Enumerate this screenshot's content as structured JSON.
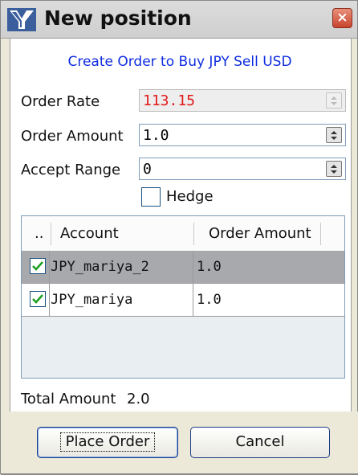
{
  "window": {
    "title": "New position",
    "close_symbol": "×"
  },
  "headline": "Create Order to Buy JPY Sell USD",
  "form": {
    "order_rate_label": "Order Rate",
    "order_rate_value": "113.15",
    "order_rate_color": "#e11a1a",
    "order_amount_label": "Order Amount",
    "order_amount_value": "1.0",
    "accept_range_label": "Accept Range",
    "accept_range_value": "0",
    "hedge_label": "Hedge",
    "hedge_checked": false
  },
  "table": {
    "columns": [
      "..",
      "Account",
      "Order Amount"
    ],
    "rows": [
      {
        "checked": true,
        "account": "JPY_mariya_2",
        "amount": "1.0",
        "selected": true
      },
      {
        "checked": true,
        "account": "JPY_mariya",
        "amount": "1.0",
        "selected": false
      }
    ]
  },
  "total": {
    "label": "Total Amount",
    "value": "2.0"
  },
  "buttons": {
    "place_order": "Place Order",
    "cancel": "Cancel"
  },
  "colors": {
    "headline": "#0f2ce0",
    "selected_row": "#a7a9ad",
    "check_mark": "#1fa023"
  }
}
